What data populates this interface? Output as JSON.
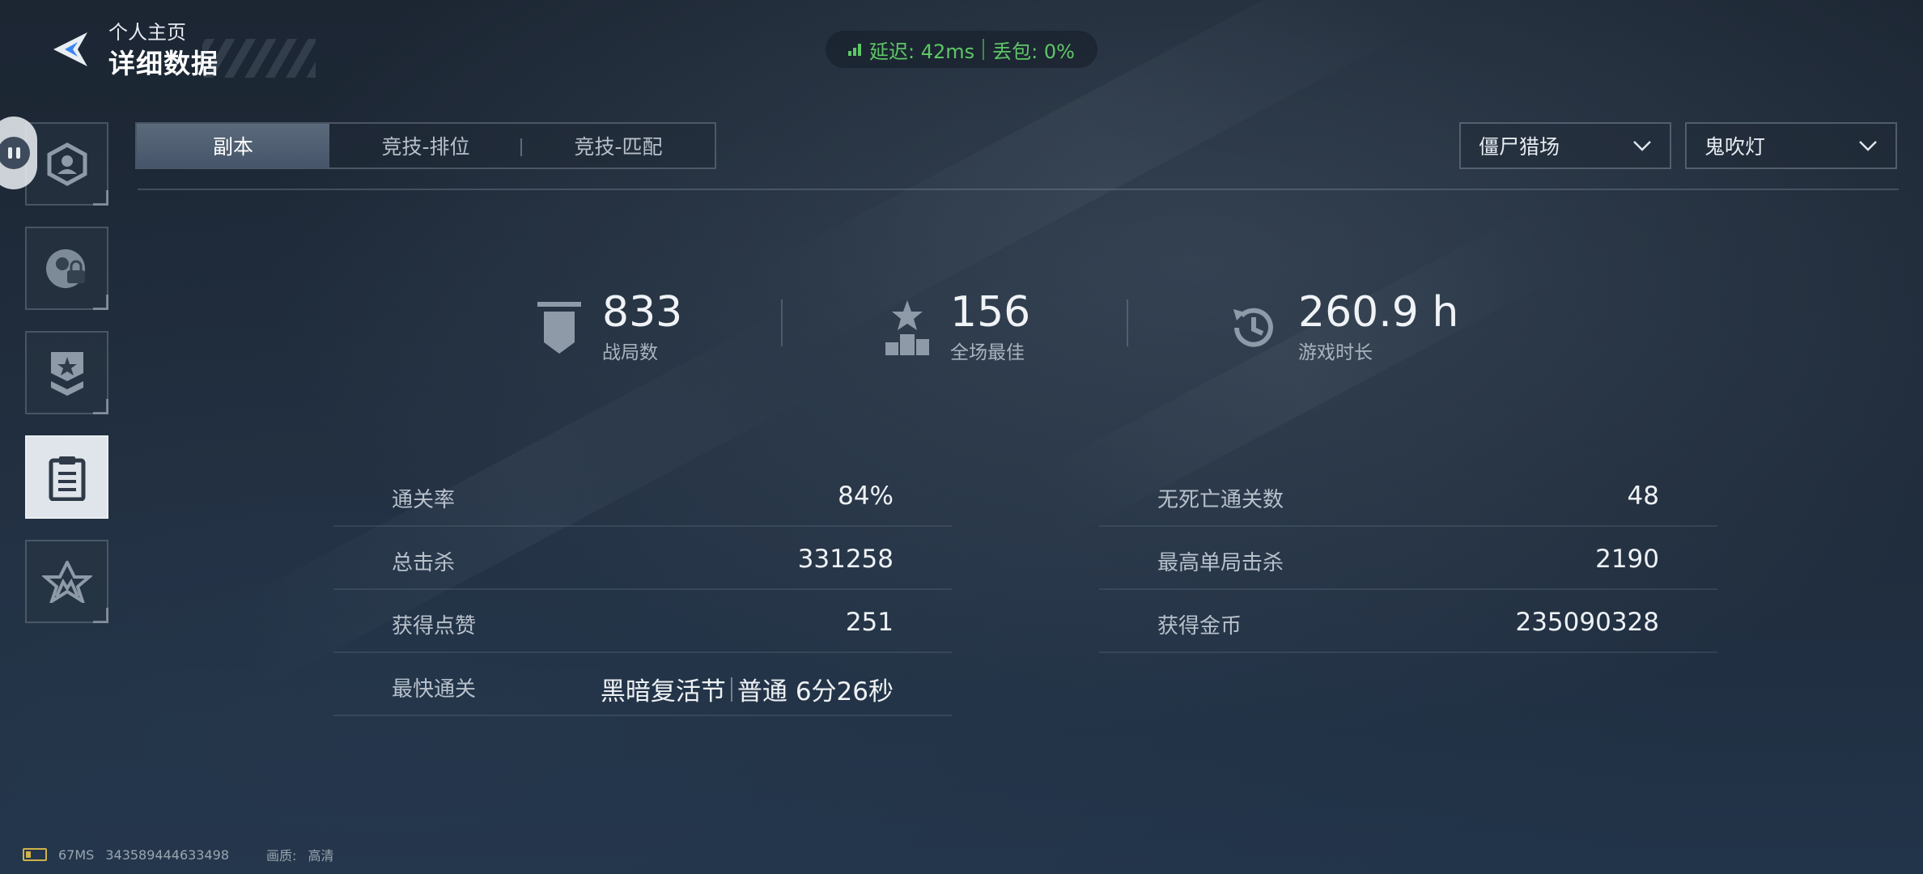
{
  "header": {
    "subtitle": "个人主页",
    "title": "详细数据"
  },
  "network": {
    "latency": "延迟: 42ms",
    "packet_loss": "丢包: 0%"
  },
  "sidebar": {
    "items": [
      {
        "icon": "profile-badge-icon"
      },
      {
        "icon": "character-lock-icon"
      },
      {
        "icon": "rank-star-shield-icon"
      },
      {
        "icon": "clipboard-icon",
        "active": true
      },
      {
        "icon": "emblem-logo-icon"
      }
    ]
  },
  "tabs": [
    {
      "label": "副本",
      "active": true
    },
    {
      "label": "竞技-排位",
      "active": false
    },
    {
      "label": "竞技-匹配",
      "active": false
    }
  ],
  "filters": {
    "mode": "僵尸猎场",
    "map": "鬼吹灯"
  },
  "summary": [
    {
      "value": "833",
      "label": "战局数",
      "icon": "banner-icon"
    },
    {
      "value": "156",
      "label": "全场最佳",
      "icon": "podium-star-icon"
    },
    {
      "value": "260.9 h",
      "label": "游戏时长",
      "icon": "clock-history-icon"
    }
  ],
  "details": {
    "left": [
      {
        "label": "通关率",
        "value": "84%"
      },
      {
        "label": "总击杀",
        "value": "331258"
      },
      {
        "label": "获得点赞",
        "value": "251"
      },
      {
        "label": "最快通关",
        "value_map": "黑暗复活节",
        "value_difficulty": "普通",
        "value_time": "6分26秒"
      }
    ],
    "right": [
      {
        "label": "无死亡通关数",
        "value": "48"
      },
      {
        "label": "最高单局击杀",
        "value": "2190"
      },
      {
        "label": "获得金币",
        "value": "235090328"
      }
    ]
  },
  "footer": {
    "ping": "67MS",
    "id": "343589444633498",
    "quality_label": "画质:",
    "quality_value": "高清"
  },
  "colors": {
    "accent_green": "#5ec766",
    "background": "#1b2634",
    "active_tab": "#4f5f71"
  }
}
